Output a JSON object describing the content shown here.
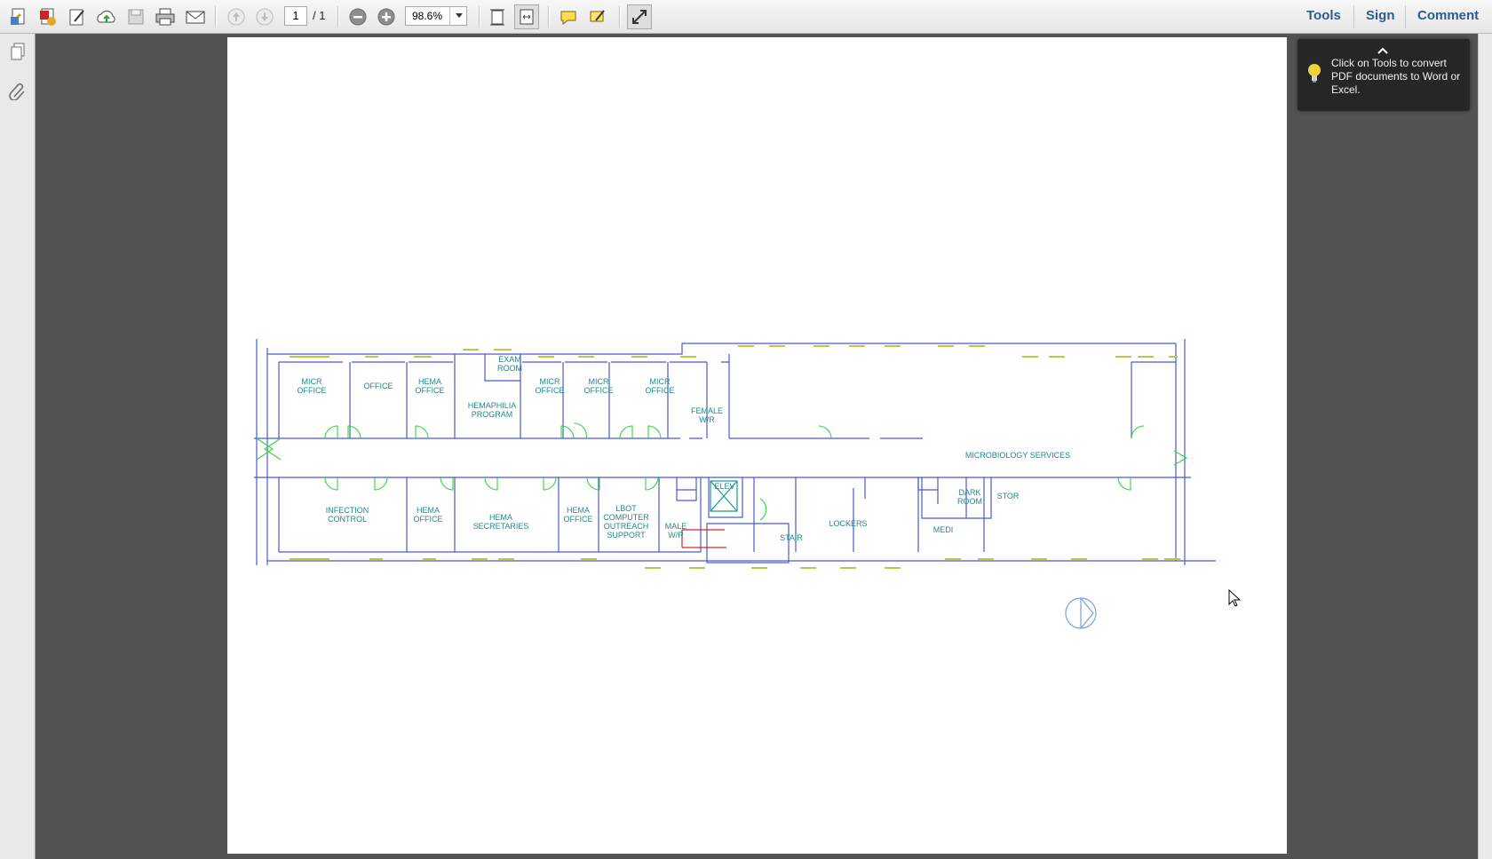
{
  "toolbar": {
    "page_current": "1",
    "page_total": "/ 1",
    "zoom": "98.6%",
    "icons": [
      "create-pdf-icon",
      "convert-pdf-icon",
      "edit-pdf-icon",
      "upload-cloud-icon",
      "save-icon",
      "print-icon",
      "email-icon",
      "previous-page-icon",
      "next-page-icon",
      "zoom-out-icon",
      "zoom-in-icon",
      "fit-page-icon",
      "fit-width-icon",
      "comment-bubble-icon",
      "highlight-icon",
      "fullscreen-icon"
    ],
    "tools_label": "Tools",
    "sign_label": "Sign",
    "comment_label": "Comment"
  },
  "sidebar": {
    "icons": [
      "pages-icon",
      "attachments-icon"
    ]
  },
  "tooltip": {
    "text": "Click on Tools to convert PDF documents to Word or Excel."
  },
  "floorplan": {
    "rooms_top": [
      [
        "MICR",
        "OFFICE"
      ],
      [
        "OFFICE"
      ],
      [
        "HEMA",
        "OFFICE"
      ],
      [
        "EXAM",
        "ROOM"
      ],
      [
        "HEMAPHILIA",
        "PROGRAM"
      ],
      [
        "MICR",
        "OFFICE"
      ],
      [
        "MICR",
        "OFFICE"
      ],
      [
        "MICR",
        "OFFICE"
      ],
      [
        "FEMALE",
        "W/R"
      ]
    ],
    "corridor_label": "MICROBIOLOGY SERVICES",
    "rooms_bottom": [
      [
        "INFECTION",
        "CONTROL"
      ],
      [
        "HEMA",
        "OFFICE"
      ],
      [
        "HEMA",
        "SECRETARIES"
      ],
      [
        "HEMA",
        "OFFICE"
      ],
      [
        "LBOT",
        "COMPUTER",
        "OUTREACH",
        "SUPPORT"
      ],
      [
        "MALE",
        "W/R"
      ],
      [
        "ELEV"
      ],
      [
        "STAIR"
      ],
      [
        "LOCKERS"
      ],
      [
        "MEDI"
      ],
      [
        "DARK",
        "ROOM"
      ],
      [
        "STOR"
      ]
    ]
  }
}
